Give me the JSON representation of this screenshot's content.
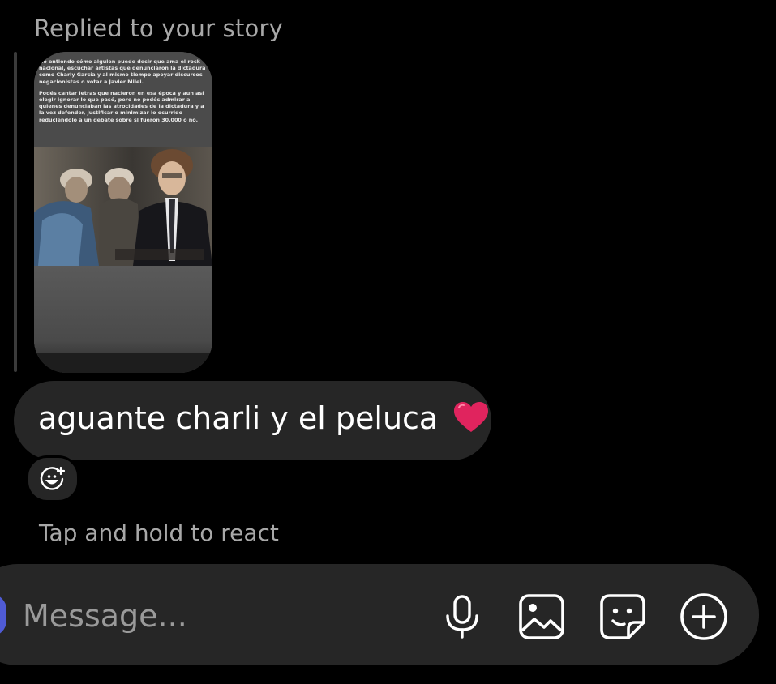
{
  "thread": {
    "reply_label": "Replied to your story",
    "story": {
      "paragraph_1": "No entiendo cómo alguien puede decir que ama el rock nacional, escuchar artistas que denunciaron la dictadura como Charly García y al mismo tiempo apoyar discursos negacionistas o votar a Javier Milei.",
      "paragraph_2": "Podés cantar letras que nacieron en esa época y aun así elegir ignorar lo que pasó, pero no podés admirar a quienes denunciaban las atrocidades de la dictadura y a la vez defender, justificar o minimizar lo ocurrido reduciéndolo a un debate sobre si fueron 30.000 o no."
    },
    "message": {
      "text": "aguante charli y el peluca",
      "emoji_icon": "red-heart-icon"
    },
    "react_button_icon": "add-reaction-icon",
    "hint": "Tap and hold to react"
  },
  "composer": {
    "placeholder": "Message...",
    "icons": [
      "microphone-icon",
      "image-icon",
      "sticker-icon",
      "plus-icon"
    ]
  },
  "colors": {
    "background": "#000000",
    "bubble": "#262626",
    "muted_text": "#a8a8a8",
    "heart": "#e0245e"
  }
}
